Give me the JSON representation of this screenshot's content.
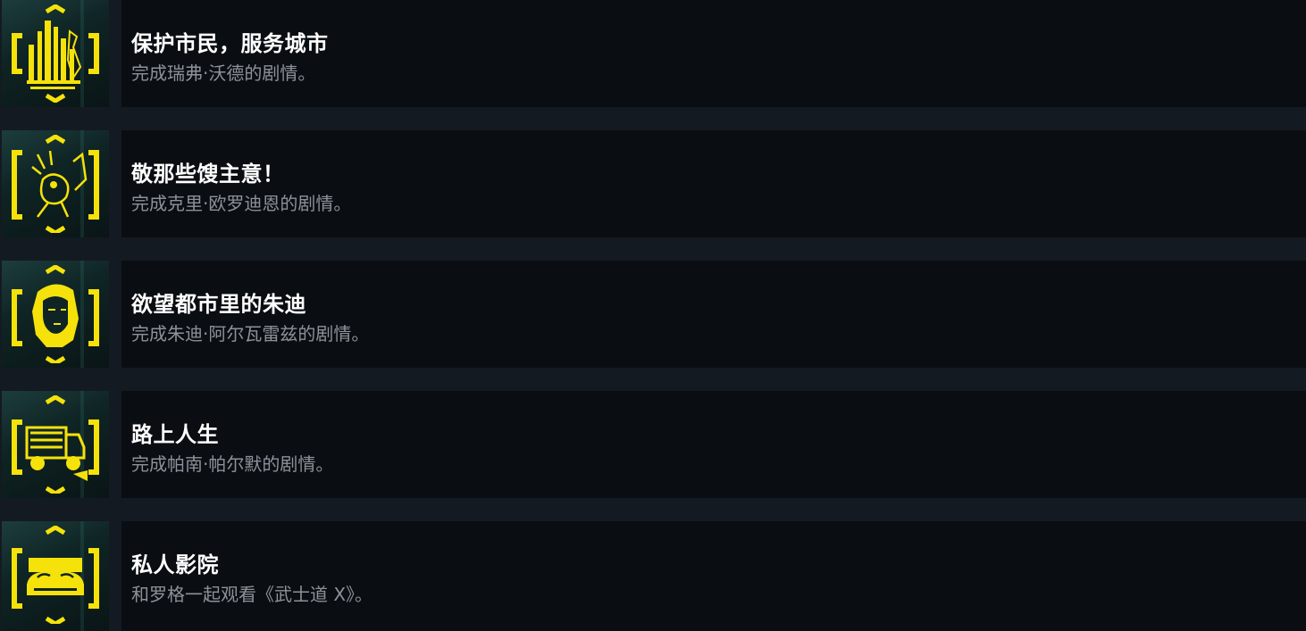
{
  "achievements": [
    {
      "title": "保护市民，服务城市",
      "description": "完成瑞弗·沃德的剧情。",
      "icon": "city-skyline-icon"
    },
    {
      "title": "敬那些馊主意！",
      "description": "完成克里·欧罗迪恩的剧情。",
      "icon": "rocker-guitar-icon"
    },
    {
      "title": "欲望都市里的朱迪",
      "description": "完成朱迪·阿尔瓦雷兹的剧情。",
      "icon": "judy-portrait-icon"
    },
    {
      "title": "路上人生",
      "description": "完成帕南·帕尔默的剧情。",
      "icon": "nomad-vehicle-icon"
    },
    {
      "title": "私人影院",
      "description": "和罗格一起观看《武士道 X》。",
      "icon": "drive-in-car-icon"
    }
  ],
  "colors": {
    "accent": "#f5e20a",
    "background": "#141a21",
    "row": "#0a0d12",
    "title": "#ffffff",
    "description": "#8c929a"
  }
}
